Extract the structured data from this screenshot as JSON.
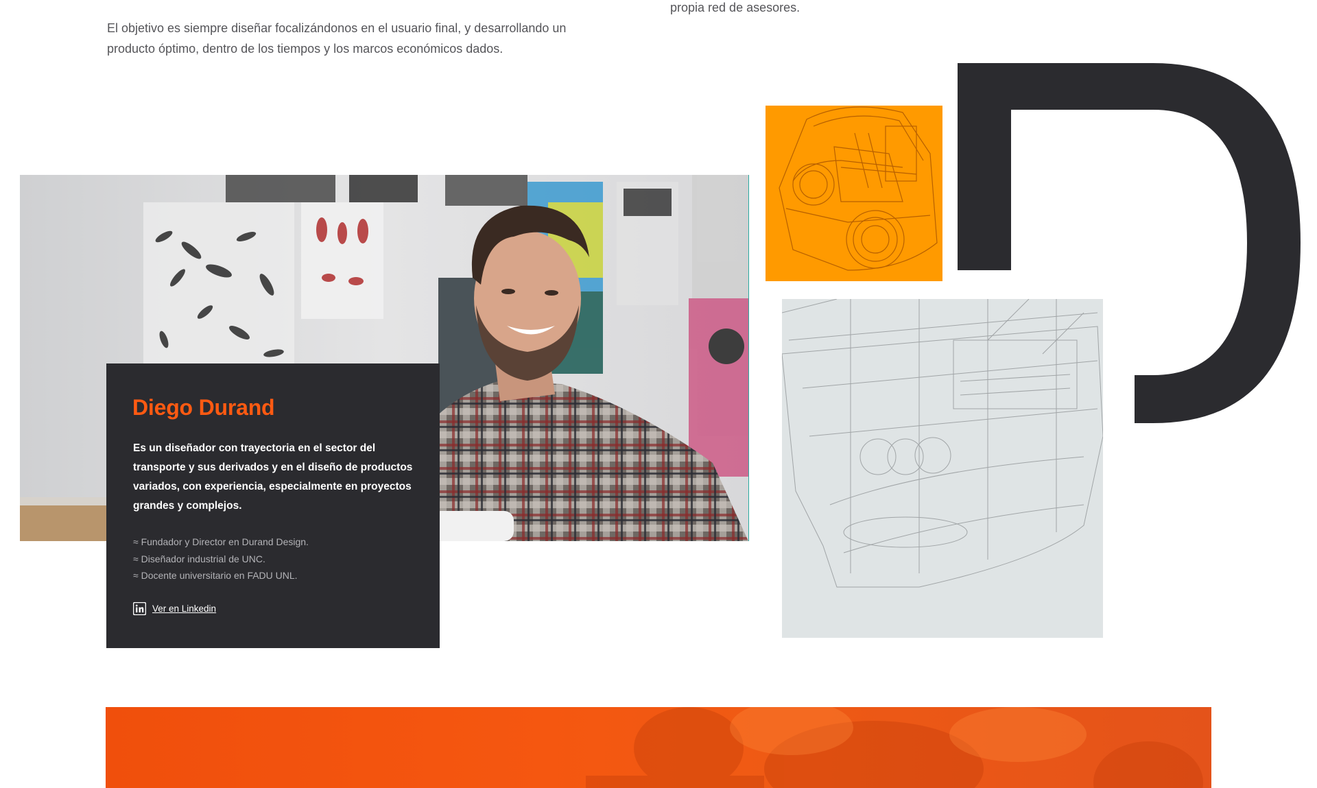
{
  "intro": {
    "left_paragraph": "El objetivo es siempre diseñar focalizándonos en el usuario final, y desarrollando un producto óptimo, dentro de los tiempos y los marcos económicos dados.",
    "right_paragraph": "propia red de asesores."
  },
  "profile": {
    "name": "Diego Durand",
    "bio": "Es un diseñador con trayectoria en el sector del transporte y sus derivados y en el diseño de productos variados, con experiencia, especialmente en proyectos grandes y complejos.",
    "credentials": [
      "Fundador y Director en Durand Design.",
      "Diseñador industrial de UNC.",
      "Docente universitario en FADU UNL."
    ],
    "linkedin_label": "Ver en Linkedin",
    "linkedin_icon": "linkedin-icon"
  },
  "colors": {
    "accent_orange": "#ff5a12",
    "tile_orange": "#ff9a00",
    "card_dark": "#2b2b2f",
    "logo_dark": "#2b2b2f"
  }
}
